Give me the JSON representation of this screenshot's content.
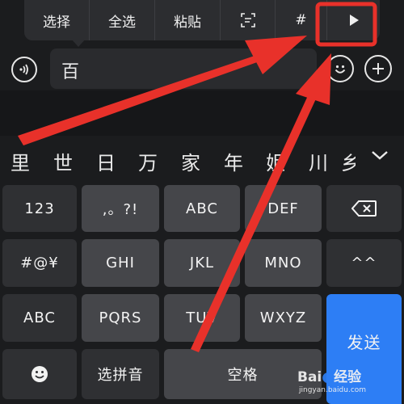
{
  "context_menu": {
    "items": [
      "选择",
      "全选",
      "粘贴",
      "scan-text-icon",
      "#",
      "play-icon"
    ]
  },
  "input": {
    "value": "百"
  },
  "candidates": [
    "里",
    "世",
    "日",
    "万",
    "家",
    "年",
    "姐",
    "川",
    "乡"
  ],
  "keyboard": {
    "row1": [
      "123",
      ",。?!",
      "ABC",
      "DEF",
      "backspace-icon"
    ],
    "row2": [
      "#@¥",
      "GHI",
      "JKL",
      "MNO",
      "^^"
    ],
    "row3": [
      "ABC",
      "PQRS",
      "TUV",
      "WXYZ"
    ],
    "row4": [
      "emoji-icon",
      "选拼音",
      "空格"
    ],
    "send": "发送"
  },
  "colors": {
    "send_key": "#2d7ef5",
    "annotation": "#e8312a",
    "keyboard_bg": "#1b1c1e",
    "key": "#45464a"
  },
  "watermark": {
    "logo_text_left": "Bai",
    "logo_text_right": "经验",
    "url": "jingyan.baidu.com"
  }
}
